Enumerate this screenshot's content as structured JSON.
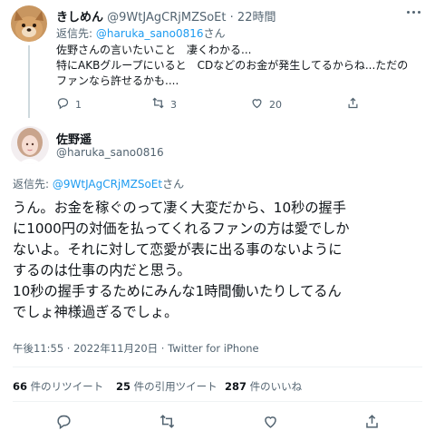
{
  "reply_tweet": {
    "author_name": "きしめん",
    "author_handle": "@9WtJAgCRjMZSoEt",
    "separator": "·",
    "time": "22時間",
    "reply_prefix": "返信先: ",
    "reply_handle": "@haruka_sano0816",
    "reply_suffix": "さん",
    "text_lines": [
      "佐野さんの言いたいこと　凄くわかる...",
      "特にAKBグループにいると　CDなどのお金が発生してるからね...ただの",
      "ファンなら許せるかも...."
    ],
    "reply_count": "1",
    "retweet_count": "3",
    "like_count": "20"
  },
  "main_tweet": {
    "author_name": "佐野遥",
    "author_handle": "@haruka_sano0816",
    "reply_prefix": "返信先: ",
    "reply_handle": "@9WtJAgCRjMZSoEt",
    "reply_suffix": "さん",
    "text_lines": [
      "うん。お金を稼ぐのって凄く大変だから、10秒の握手",
      "に1000円の対価を払ってくれるファンの方は愛でしか",
      "ないよ。それに対して恋愛が表に出る事のないように",
      "するのは仕事の内だと思う。",
      "10秒の握手するためにみんな1時間働いたりしてるん",
      "でしょ神様過ぎるでしょ。"
    ],
    "timestamp": "午後11:55 · 2022年11月20日 · Twitter for iPhone",
    "stats": {
      "retweets_count": "66",
      "retweets_label": " 件のリツイート",
      "quotes_count": "25",
      "quotes_label": " 件の引用ツイート",
      "likes_count": "287",
      "likes_label": " 件のいいね"
    }
  },
  "icons": {
    "reply": "speech-bubble-icon",
    "retweet": "retweet-arrows-icon",
    "like": "heart-icon",
    "share": "share-upload-icon",
    "more": "more-dots-icon"
  },
  "colors": {
    "link": "#1d9bf0",
    "secondary_text": "#536471",
    "primary_text": "#0f1419",
    "divider": "#eff3f4"
  }
}
